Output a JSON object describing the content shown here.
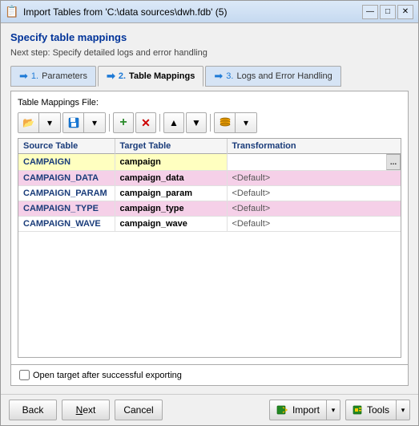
{
  "window": {
    "title": "Import Tables from 'C:\\data sources\\dwh.fdb' (5)",
    "icon": "📋"
  },
  "heading": "Specify table mappings",
  "subheading": "Next step: Specify detailed logs and error handling",
  "tabs": [
    {
      "id": "params",
      "number": "1.",
      "label": "Parameters",
      "active": false
    },
    {
      "id": "mappings",
      "number": "2.",
      "label": "Table Mappings",
      "active": true
    },
    {
      "id": "logs",
      "number": "3.",
      "label": "Logs and Error Handling",
      "active": false
    }
  ],
  "file_label": "Table Mappings File:",
  "toolbar": {
    "open_label": "📂",
    "save_label": "💾",
    "add_label": "+",
    "delete_label": "✕",
    "up_label": "▲",
    "down_label": "▼",
    "db_label": "🗄"
  },
  "table": {
    "headers": [
      "Source Table",
      "Target Table",
      "Transformation"
    ],
    "rows": [
      {
        "source": "CAMPAIGN",
        "target": "campaign",
        "transform": "",
        "selected": true,
        "editing": true
      },
      {
        "source": "CAMPAIGN_DATA",
        "target": "campaign_data",
        "transform": "<Default>",
        "selected": false,
        "alt": true
      },
      {
        "source": "CAMPAIGN_PARAM",
        "target": "campaign_param",
        "transform": "<Default>",
        "selected": false,
        "alt": false
      },
      {
        "source": "CAMPAIGN_TYPE",
        "target": "campaign_type",
        "transform": "<Default>",
        "selected": false,
        "alt": true
      },
      {
        "source": "CAMPAIGN_WAVE",
        "target": "campaign_wave",
        "transform": "<Default>",
        "selected": false,
        "alt": false
      }
    ]
  },
  "footer": {
    "checkbox_label": "Open target after successful exporting",
    "checkbox_checked": false
  },
  "buttons": {
    "back": "Back",
    "next_label": "N",
    "next_rest": "ext",
    "cancel": "Cancel",
    "import": "Import",
    "tools": "Tools"
  },
  "title_controls": {
    "minimize": "—",
    "maximize": "□",
    "close": "✕"
  }
}
